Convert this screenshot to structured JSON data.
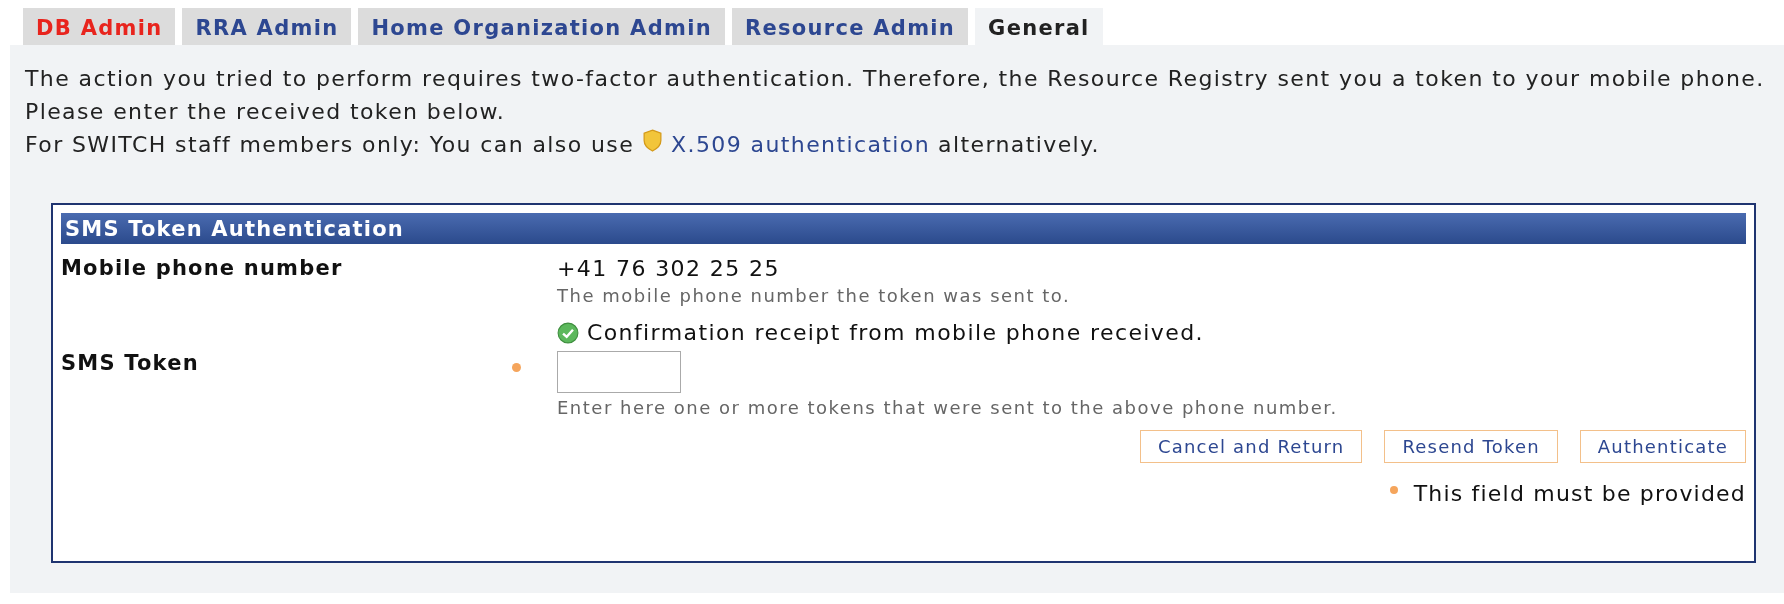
{
  "tabs": [
    {
      "label": "DB Admin",
      "selected": false,
      "kind": "alert"
    },
    {
      "label": "RRA Admin",
      "selected": false,
      "kind": "normal"
    },
    {
      "label": "Home Organization Admin",
      "selected": false,
      "kind": "normal"
    },
    {
      "label": "Resource Admin",
      "selected": false,
      "kind": "normal"
    },
    {
      "label": "General",
      "selected": true,
      "kind": "normal"
    }
  ],
  "intro": {
    "lines": [
      "The action you tried to perform requires two-factor authentication. Therefore, the Resource Registry sent you a token to your mobile phone.",
      "Please enter the received token below."
    ],
    "alt_prefix": "For SWITCH staff members only: You can also use",
    "alt_link": "X.509 authentication",
    "alt_suffix": "alternatively."
  },
  "form": {
    "title": "SMS Token Authentication",
    "fields": [
      {
        "kind": "readonly",
        "label": "Mobile phone number",
        "required": false,
        "value": "+41 76 302 25 25",
        "hint": "The mobile phone number the token was sent to.",
        "status": "Confirmation receipt from mobile phone received."
      },
      {
        "kind": "input",
        "label": "SMS Token",
        "required": true,
        "hint": "Enter here one or more tokens that were sent to the above phone number."
      }
    ],
    "buttons": [
      "Cancel and Return",
      "Resend Token",
      "Authenticate"
    ],
    "required_legend": "This field must be provided"
  }
}
